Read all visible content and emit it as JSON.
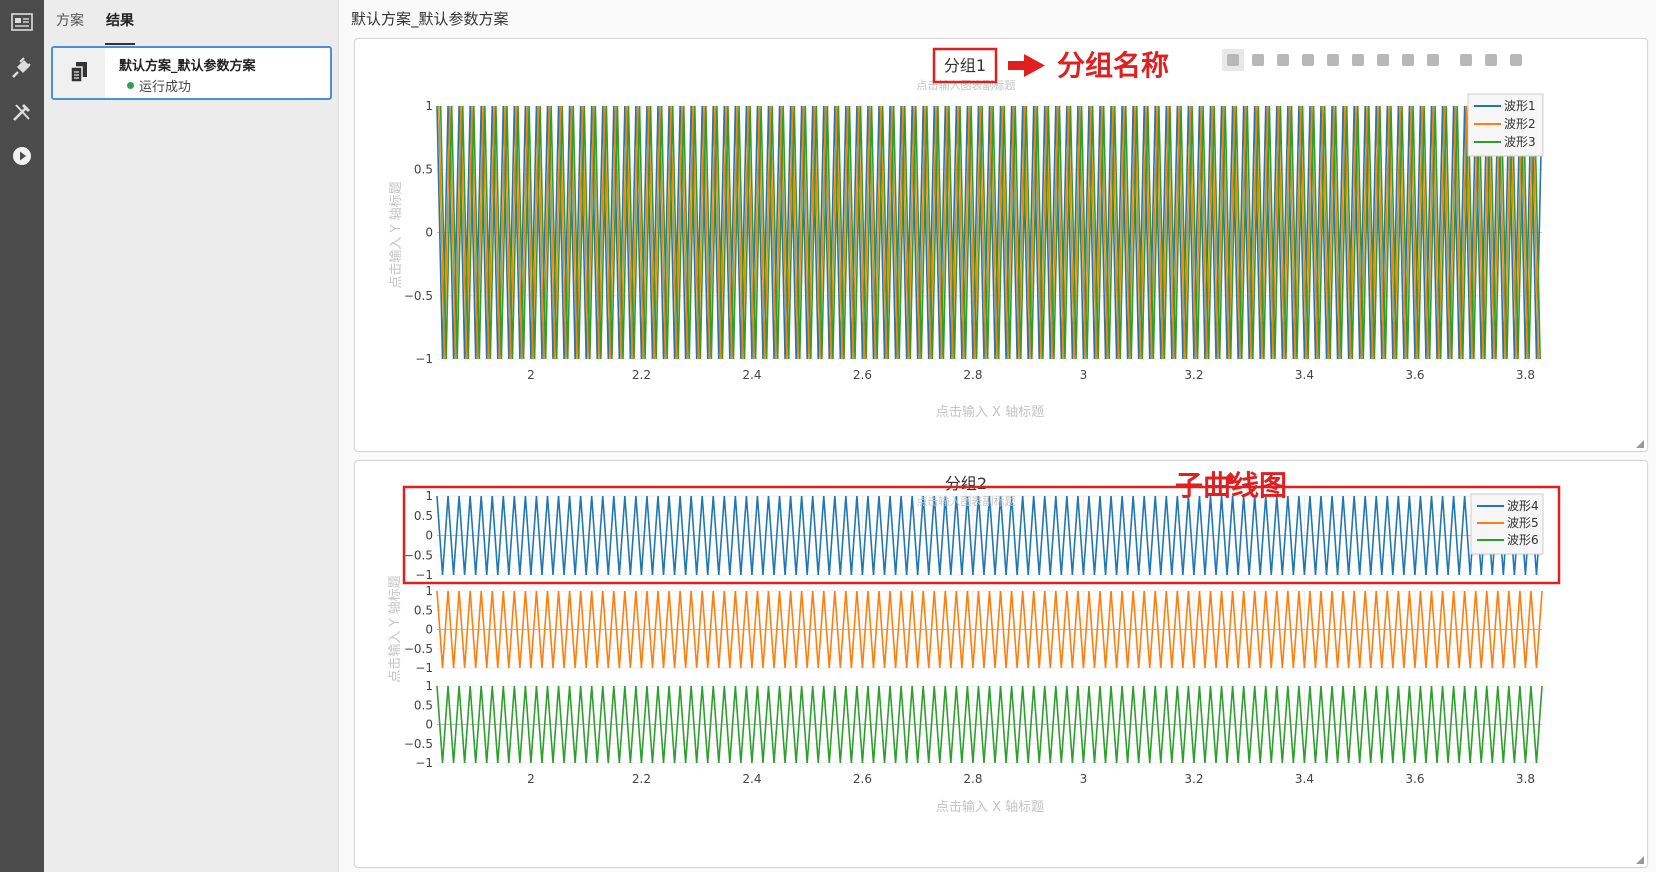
{
  "activity_bar": {
    "items": [
      {
        "name": "dashboard-icon"
      },
      {
        "name": "plugin-icon"
      },
      {
        "name": "tools-icon"
      },
      {
        "name": "run-icon"
      }
    ]
  },
  "left_panel": {
    "tabs": [
      {
        "label": "方案",
        "active": false
      },
      {
        "label": "结果",
        "active": true
      }
    ],
    "result_item": {
      "title": "默认方案_默认参数方案",
      "status": "运行成功",
      "status_color": "#2e9e5a",
      "icon": "documents-icon"
    }
  },
  "main": {
    "title": "默认方案_默认参数方案",
    "toolbar": {
      "icons": [
        "zoom-icon",
        "pan-icon",
        "zoom-in-icon",
        "zoom-out-icon",
        "autoscale-icon",
        "reset-axes-icon",
        "spike-lines-icon",
        "hover-closest-icon",
        "hover-compare-icon",
        "download-icon",
        "camera-icon",
        "edit-icon"
      ]
    },
    "annotations": {
      "group_name_label": "分组名称",
      "subplot_label": "子曲线图",
      "annotation_color": "#e02020"
    },
    "group1": {
      "title": "分组1",
      "subtitle_placeholder": "点击输入图表副标题",
      "x_axis_title": "点击输入 X 轴标题",
      "y_axis_title": "点击输入 Y 轴标题"
    },
    "group2": {
      "title": "分组2",
      "subtitle_placeholder": "点击输入图表副标题",
      "x_axis_title": "点击输入 X 轴标题",
      "y_axis_title": "点击输入 Y 轴标题"
    }
  },
  "chart_data": [
    {
      "type": "line",
      "title": "分组1",
      "xlim": [
        1.83,
        3.83
      ],
      "ylim": [
        -1,
        1
      ],
      "x_ticks": [
        "2",
        "2.2",
        "2.4",
        "2.6",
        "2.8",
        "3",
        "3.2",
        "3.4",
        "3.6",
        "3.8"
      ],
      "y_ticks": [
        "1",
        "0.5",
        "0",
        "−0.5",
        "−1"
      ],
      "legend_position": "top-right",
      "grid": true,
      "series": [
        {
          "name": "波形1",
          "color": "#1f77b4",
          "waveform": "triangle",
          "amplitude": 1,
          "cycles_in_view": 100
        },
        {
          "name": "波形2",
          "color": "#ff7f0e",
          "waveform": "triangle",
          "amplitude": 1,
          "cycles_in_view": 100
        },
        {
          "name": "波形3",
          "color": "#2ca02c",
          "waveform": "triangle",
          "amplitude": 1,
          "cycles_in_view": 100
        }
      ]
    },
    {
      "type": "line",
      "title": "分组2",
      "xlim": [
        1.83,
        3.83
      ],
      "x_ticks": [
        "2",
        "2.2",
        "2.4",
        "2.6",
        "2.8",
        "3",
        "3.2",
        "3.4",
        "3.6",
        "3.8"
      ],
      "legend_position": "top-right",
      "grid": true,
      "subplots": [
        {
          "ylim": [
            -1,
            1
          ],
          "y_ticks": [
            "1",
            "0.5",
            "0",
            "−0.5",
            "−1"
          ],
          "series": [
            {
              "name": "波形4",
              "color": "#1f77b4",
              "waveform": "triangle",
              "amplitude": 1,
              "cycles_in_view": 100
            }
          ]
        },
        {
          "ylim": [
            -1,
            1
          ],
          "y_ticks": [
            "1",
            "0.5",
            "0",
            "−0.5",
            "−1"
          ],
          "series": [
            {
              "name": "波形5",
              "color": "#ff7f0e",
              "waveform": "triangle",
              "amplitude": 1,
              "cycles_in_view": 100
            }
          ]
        },
        {
          "ylim": [
            -1,
            1
          ],
          "y_ticks": [
            "1",
            "0.5",
            "0",
            "−0.5",
            "−1"
          ],
          "series": [
            {
              "name": "波形6",
              "color": "#2ca02c",
              "waveform": "triangle",
              "amplitude": 1,
              "cycles_in_view": 100
            }
          ]
        }
      ]
    }
  ]
}
